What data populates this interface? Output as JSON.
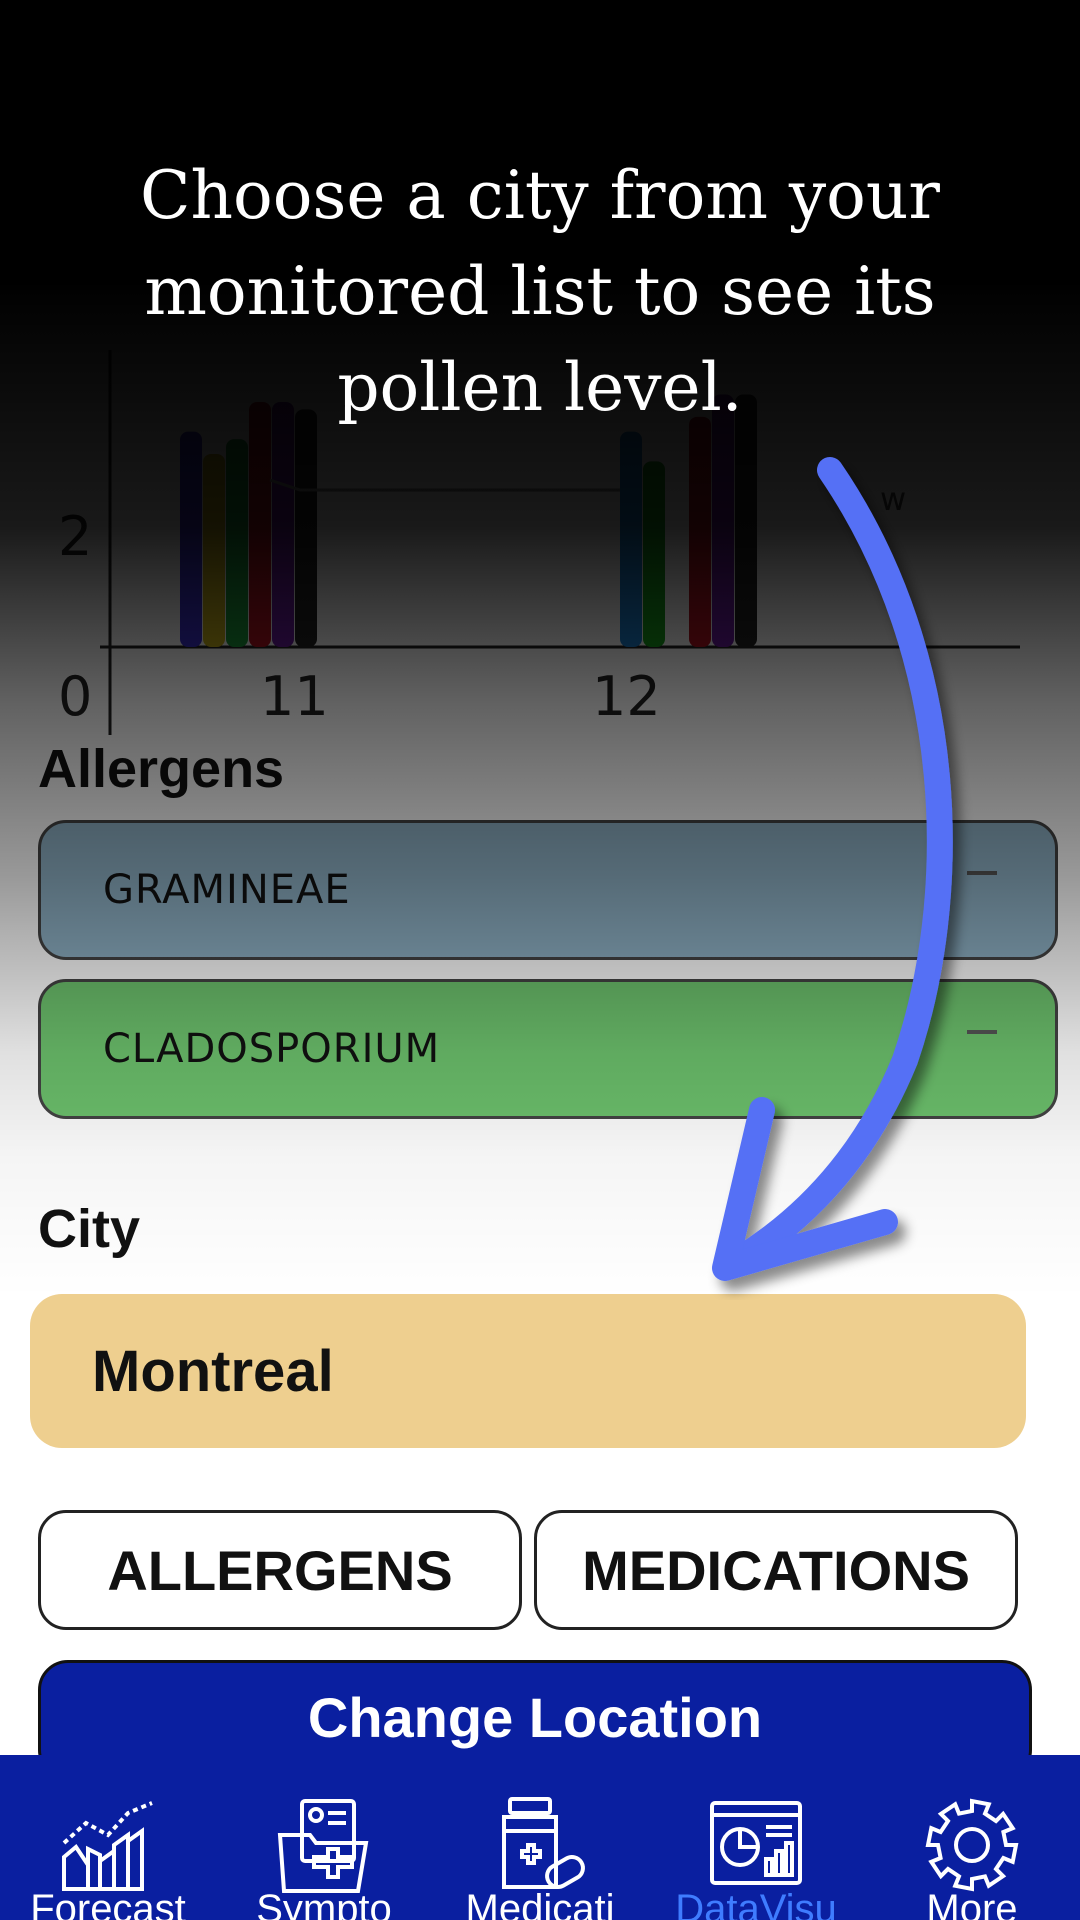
{
  "coach_mark": {
    "line1": "Choose a city from your",
    "line2": "monitored list to see its",
    "line3": "pollen level."
  },
  "chart_data": {
    "type": "bar",
    "categories": [
      "11",
      "12"
    ],
    "y_ticks": [
      "0",
      "2"
    ],
    "partial_legend_text": "w",
    "series": [
      {
        "values": [
          2.9,
          0.0
        ]
      },
      {
        "values": [
          2.6,
          0.0
        ]
      },
      {
        "values": [
          2.8,
          0.0
        ]
      },
      {
        "values": [
          3.3,
          3.1
        ]
      },
      {
        "values": [
          3.3,
          3.4
        ]
      },
      {
        "values": [
          3.2,
          3.4
        ]
      },
      {
        "values": [
          0.0,
          2.9
        ]
      },
      {
        "values": [
          0.0,
          2.5
        ]
      }
    ],
    "ylim": [
      0,
      4
    ]
  },
  "allergens": {
    "title": "Allergens",
    "items": [
      {
        "name": "GRAMINEAE",
        "color": "#8fb2c6"
      },
      {
        "name": "CLADOSPORIUM",
        "color": "#6dc26d"
      }
    ]
  },
  "city": {
    "title": "City",
    "selected": "Montreal",
    "color": "#eecf8f"
  },
  "buttons": {
    "allergens": "ALLERGENS",
    "medications": "MEDICATIONS",
    "change_location": "Change Location"
  },
  "nav": {
    "items": [
      {
        "label": "Forecast",
        "icon": "forecast-chart-icon",
        "active": false
      },
      {
        "label": "Sympto",
        "icon": "symptoms-folder-icon",
        "active": false
      },
      {
        "label": "Medicati",
        "icon": "medication-bottle-icon",
        "active": false
      },
      {
        "label": "DataVisu",
        "icon": "data-dashboard-icon",
        "active": true
      },
      {
        "label": "More",
        "icon": "gear-icon",
        "active": false
      }
    ]
  },
  "colors": {
    "primary_blue": "#0a1fa0",
    "active_nav": "#3f7cff",
    "arrow": "#5470f5"
  }
}
